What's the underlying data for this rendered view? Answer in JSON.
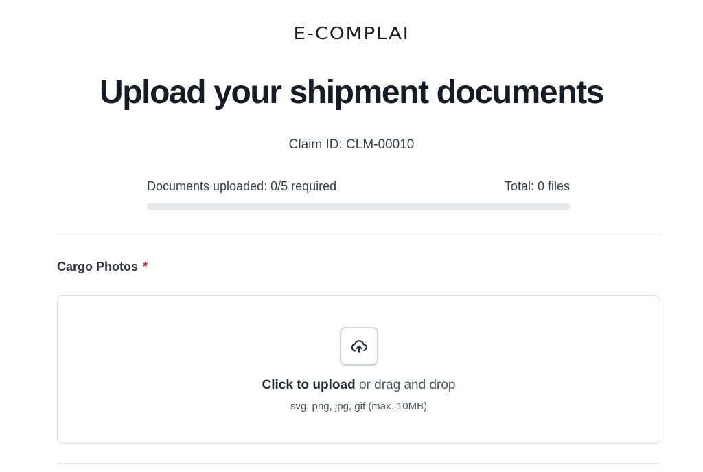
{
  "brand": {
    "logo_text": "E-COMPLAI"
  },
  "header": {
    "title": "Upload your shipment documents",
    "claim_id": "Claim ID: CLM-00010"
  },
  "progress": {
    "uploaded_label": "Documents uploaded: 0/5 required",
    "total_label": "Total: 0 files",
    "uploaded": 0,
    "required": 5,
    "fraction": 0
  },
  "sections": [
    {
      "label": "Cargo Photos",
      "required_marker": "*",
      "dropzone": {
        "icon": "cloud-upload-icon",
        "action_text": "Click to upload",
        "secondary_text": "or drag and drop",
        "hint": "svg, png, jpg, gif (max. 10MB)"
      }
    }
  ],
  "colors": {
    "text_dark": "#161b26",
    "text_body": "#374151",
    "required": "#d92d20",
    "track": "#e5e7eb",
    "border": "#dcdfe4"
  }
}
